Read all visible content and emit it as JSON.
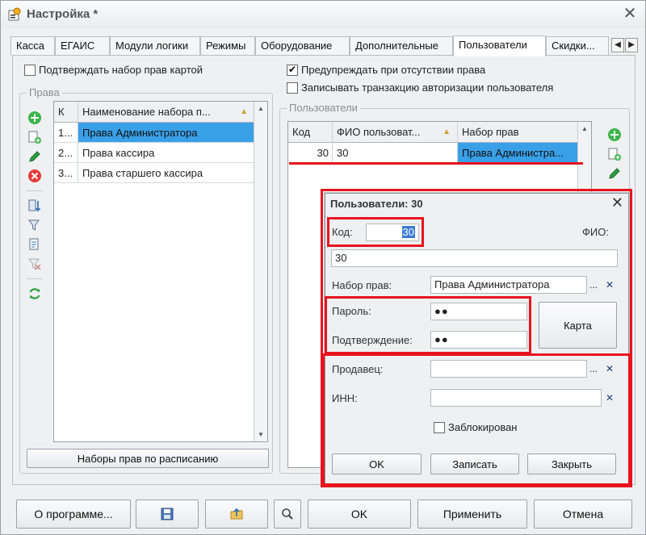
{
  "window": {
    "title": "Настройка *"
  },
  "tabs": [
    {
      "label": "Касса"
    },
    {
      "label": "ЕГАИС"
    },
    {
      "label": "Модули логики"
    },
    {
      "label": "Режимы"
    },
    {
      "label": "Оборудование"
    },
    {
      "label": "Дополнительные"
    },
    {
      "label": "Пользователи",
      "active": true
    },
    {
      "label": "Скидки..."
    }
  ],
  "options": {
    "confirm_rights_by_card": "Подтверждать набор прав картой",
    "warn_missing_rights": "Предупреждать при отсутствии права",
    "log_auth_transaction": "Записывать транзакцию авторизации пользователя"
  },
  "rights": {
    "group_title": "Права",
    "columns": [
      "К",
      "Наименование набора п..."
    ],
    "rows": [
      {
        "code": "1...",
        "name": "Права Администратора"
      },
      {
        "code": "2...",
        "name": "Права кассира"
      },
      {
        "code": "3...",
        "name": "Права старшего кассира"
      }
    ],
    "schedule_button": "Наборы прав по расписанию"
  },
  "users": {
    "group_title": "Пользователи",
    "columns": [
      "Код",
      "ФИО пользоват...",
      "Набор прав"
    ],
    "rows": [
      {
        "code": "30",
        "name": "30",
        "rights": "Права Администра..."
      }
    ]
  },
  "dialog": {
    "title": "Пользователи: 30",
    "code_label": "Код:",
    "code_value": "30",
    "fio_label": "ФИО:",
    "fio_value": "30",
    "rights_label": "Набор прав:",
    "rights_value": "Права Администратора",
    "password_label": "Пароль:",
    "password_value": "●●",
    "confirm_label": "Подтверждение:",
    "confirm_value": "●●",
    "card_button": "Карта",
    "seller_label": "Продавец:",
    "seller_value": "",
    "inn_label": "ИНН:",
    "inn_value": "",
    "blocked_label": "Заблокирован",
    "ok_button": "OK",
    "save_button": "Записать",
    "close_button": "Закрыть",
    "ellipsis": "...",
    "clear": "✕"
  },
  "footer": {
    "about": "О программе...",
    "ok": "OK",
    "apply": "Применить",
    "cancel": "Отмена"
  },
  "colors": {
    "selection": "#39a0e8",
    "highlight": "#e8131f"
  }
}
